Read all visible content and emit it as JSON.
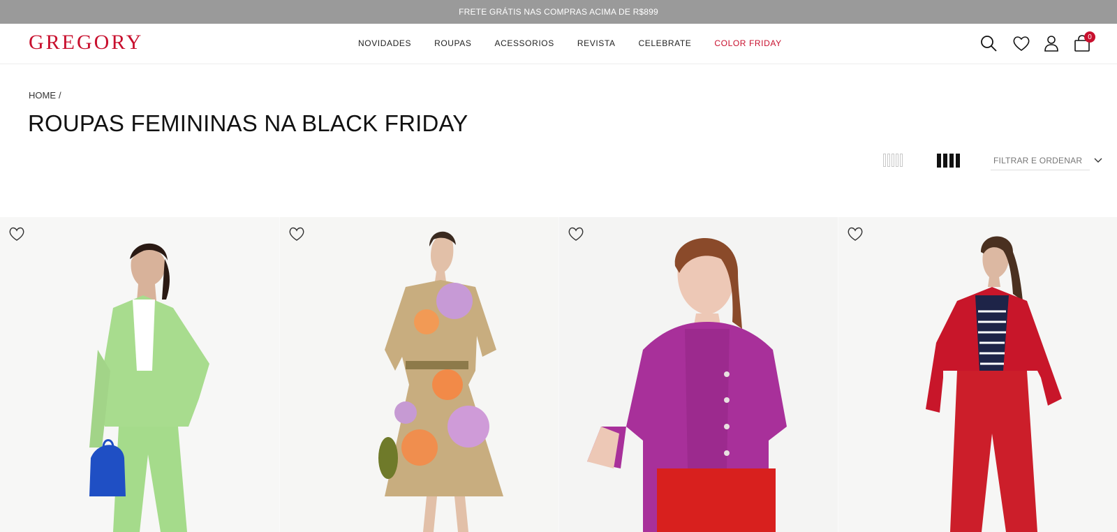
{
  "promo": {
    "text": "FRETE GRÁTIS NAS COMPRAS ACIMA DE R$899"
  },
  "header": {
    "logo": "GREGORY",
    "nav": [
      "NOVIDADES",
      "ROUPAS",
      "ACESSORIOS",
      "REVISTA",
      "CELEBRATE",
      "COLOR FRIDAY"
    ],
    "cart_count": "0",
    "icons": [
      "search-icon",
      "heart-icon",
      "user-icon",
      "bag-icon"
    ]
  },
  "breadcrumb": {
    "home": "HOME",
    "separator": "/"
  },
  "page_title": "ROUPAS FEMININAS NA BLACK FRIDAY",
  "toolbar": {
    "filter_label": "FILTRAR E ORDENAR",
    "grid_options": [
      "5-columns",
      "4-columns"
    ],
    "selected_grid": "4-columns"
  },
  "colors": {
    "brand": "#c8102e",
    "promo_bg": "#9a9a9a",
    "text": "#111111"
  },
  "products": [
    {
      "outfit": "green blazer and trousers with blue bag"
    },
    {
      "outfit": "floral print wrap dress"
    },
    {
      "outfit": "magenta knit cardigan set with red skirt"
    },
    {
      "outfit": "red jacket with striped top and red trousers"
    }
  ]
}
